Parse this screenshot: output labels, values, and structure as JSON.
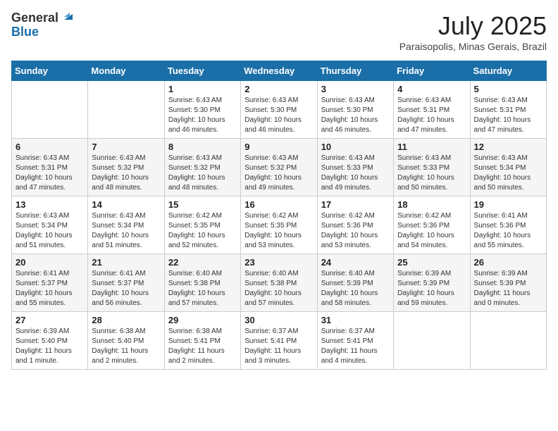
{
  "logo": {
    "general": "General",
    "blue": "Blue"
  },
  "title": "July 2025",
  "subtitle": "Paraisopolis, Minas Gerais, Brazil",
  "days_of_week": [
    "Sunday",
    "Monday",
    "Tuesday",
    "Wednesday",
    "Thursday",
    "Friday",
    "Saturday"
  ],
  "weeks": [
    [
      {
        "day": "",
        "info": ""
      },
      {
        "day": "",
        "info": ""
      },
      {
        "day": "1",
        "info": "Sunrise: 6:43 AM\nSunset: 5:30 PM\nDaylight: 10 hours and 46 minutes."
      },
      {
        "day": "2",
        "info": "Sunrise: 6:43 AM\nSunset: 5:30 PM\nDaylight: 10 hours and 46 minutes."
      },
      {
        "day": "3",
        "info": "Sunrise: 6:43 AM\nSunset: 5:30 PM\nDaylight: 10 hours and 46 minutes."
      },
      {
        "day": "4",
        "info": "Sunrise: 6:43 AM\nSunset: 5:31 PM\nDaylight: 10 hours and 47 minutes."
      },
      {
        "day": "5",
        "info": "Sunrise: 6:43 AM\nSunset: 5:31 PM\nDaylight: 10 hours and 47 minutes."
      }
    ],
    [
      {
        "day": "6",
        "info": "Sunrise: 6:43 AM\nSunset: 5:31 PM\nDaylight: 10 hours and 47 minutes."
      },
      {
        "day": "7",
        "info": "Sunrise: 6:43 AM\nSunset: 5:32 PM\nDaylight: 10 hours and 48 minutes."
      },
      {
        "day": "8",
        "info": "Sunrise: 6:43 AM\nSunset: 5:32 PM\nDaylight: 10 hours and 48 minutes."
      },
      {
        "day": "9",
        "info": "Sunrise: 6:43 AM\nSunset: 5:32 PM\nDaylight: 10 hours and 49 minutes."
      },
      {
        "day": "10",
        "info": "Sunrise: 6:43 AM\nSunset: 5:33 PM\nDaylight: 10 hours and 49 minutes."
      },
      {
        "day": "11",
        "info": "Sunrise: 6:43 AM\nSunset: 5:33 PM\nDaylight: 10 hours and 50 minutes."
      },
      {
        "day": "12",
        "info": "Sunrise: 6:43 AM\nSunset: 5:34 PM\nDaylight: 10 hours and 50 minutes."
      }
    ],
    [
      {
        "day": "13",
        "info": "Sunrise: 6:43 AM\nSunset: 5:34 PM\nDaylight: 10 hours and 51 minutes."
      },
      {
        "day": "14",
        "info": "Sunrise: 6:43 AM\nSunset: 5:34 PM\nDaylight: 10 hours and 51 minutes."
      },
      {
        "day": "15",
        "info": "Sunrise: 6:42 AM\nSunset: 5:35 PM\nDaylight: 10 hours and 52 minutes."
      },
      {
        "day": "16",
        "info": "Sunrise: 6:42 AM\nSunset: 5:35 PM\nDaylight: 10 hours and 53 minutes."
      },
      {
        "day": "17",
        "info": "Sunrise: 6:42 AM\nSunset: 5:36 PM\nDaylight: 10 hours and 53 minutes."
      },
      {
        "day": "18",
        "info": "Sunrise: 6:42 AM\nSunset: 5:36 PM\nDaylight: 10 hours and 54 minutes."
      },
      {
        "day": "19",
        "info": "Sunrise: 6:41 AM\nSunset: 5:36 PM\nDaylight: 10 hours and 55 minutes."
      }
    ],
    [
      {
        "day": "20",
        "info": "Sunrise: 6:41 AM\nSunset: 5:37 PM\nDaylight: 10 hours and 55 minutes."
      },
      {
        "day": "21",
        "info": "Sunrise: 6:41 AM\nSunset: 5:37 PM\nDaylight: 10 hours and 56 minutes."
      },
      {
        "day": "22",
        "info": "Sunrise: 6:40 AM\nSunset: 5:38 PM\nDaylight: 10 hours and 57 minutes."
      },
      {
        "day": "23",
        "info": "Sunrise: 6:40 AM\nSunset: 5:38 PM\nDaylight: 10 hours and 57 minutes."
      },
      {
        "day": "24",
        "info": "Sunrise: 6:40 AM\nSunset: 5:39 PM\nDaylight: 10 hours and 58 minutes."
      },
      {
        "day": "25",
        "info": "Sunrise: 6:39 AM\nSunset: 5:39 PM\nDaylight: 10 hours and 59 minutes."
      },
      {
        "day": "26",
        "info": "Sunrise: 6:39 AM\nSunset: 5:39 PM\nDaylight: 11 hours and 0 minutes."
      }
    ],
    [
      {
        "day": "27",
        "info": "Sunrise: 6:39 AM\nSunset: 5:40 PM\nDaylight: 11 hours and 1 minute."
      },
      {
        "day": "28",
        "info": "Sunrise: 6:38 AM\nSunset: 5:40 PM\nDaylight: 11 hours and 2 minutes."
      },
      {
        "day": "29",
        "info": "Sunrise: 6:38 AM\nSunset: 5:41 PM\nDaylight: 11 hours and 2 minutes."
      },
      {
        "day": "30",
        "info": "Sunrise: 6:37 AM\nSunset: 5:41 PM\nDaylight: 11 hours and 3 minutes."
      },
      {
        "day": "31",
        "info": "Sunrise: 6:37 AM\nSunset: 5:41 PM\nDaylight: 11 hours and 4 minutes."
      },
      {
        "day": "",
        "info": ""
      },
      {
        "day": "",
        "info": ""
      }
    ]
  ]
}
